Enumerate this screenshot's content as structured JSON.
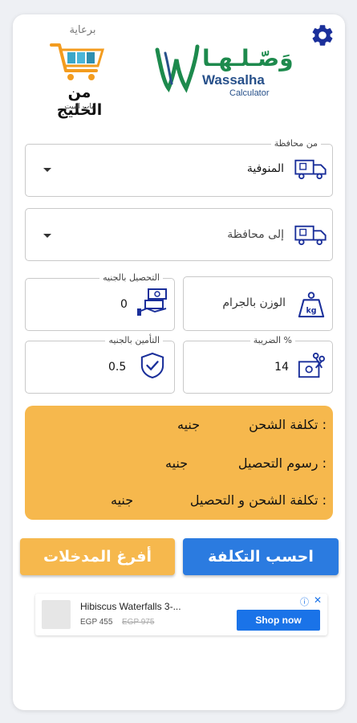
{
  "header": {
    "logo_arabic": "وَصّـلـهـا",
    "logo_english": "Wassalha",
    "logo_sub": "Calculator",
    "sponsor_label": "برعاية",
    "sponsor_name": "من الخليج",
    "sponsor_tagline": "لباب البيت"
  },
  "form": {
    "from_legend": "من محافظة",
    "from_value": "المنوفية",
    "to_value": "إلى محافظة",
    "weight_placeholder": "الوزن بالجرام",
    "collection_legend": "التحصيل بالجنيه",
    "collection_value": "0",
    "tax_legend": "الضريبة %",
    "tax_value": "14",
    "insurance_legend": "التأمين بالجنيه",
    "insurance_value": "0.5"
  },
  "results": {
    "shipping_label": "تكلفة الشحن :",
    "shipping_unit": "جنيه",
    "collection_label": "رسوم التحصيل :",
    "collection_unit": "جنيه",
    "total_label": "تكلفة الشحن و التحصيل :",
    "total_unit": "جنيه"
  },
  "buttons": {
    "calculate": "احسب التكلفة",
    "clear": "أفرغ المدخلات"
  },
  "ad": {
    "title": "Hibiscus Waterfalls 3-...",
    "price": "EGP 455",
    "old_price": "EGP 975",
    "cta": "Shop now",
    "info": "ⓘ",
    "close": "✕"
  },
  "colors": {
    "primary": "#2b7be0",
    "accent": "#f6b84d",
    "icon_blue": "#1a2f9a"
  }
}
